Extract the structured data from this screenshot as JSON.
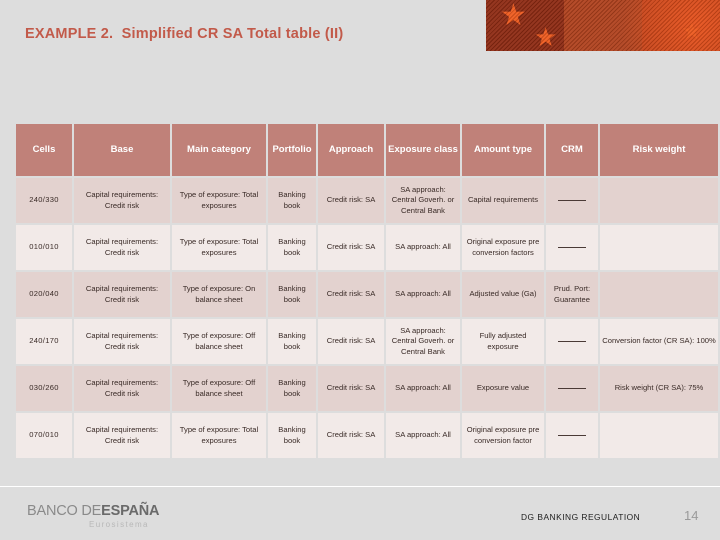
{
  "slide": {
    "title": "EXAMPLE 2.  Simplified CR SA Total table (II)",
    "title_color": "#c25a4a",
    "background_color": "#dddddd"
  },
  "banner": {
    "name": "spain-flag-graphic",
    "colors": [
      "#8e2a12",
      "#b0411d",
      "#bf3f17",
      "#ef5a1e"
    ],
    "star_glyph": "★"
  },
  "table": {
    "header_color": "#c08179",
    "row_dark_color": "#e3d2cf",
    "row_light_color": "#f2eae8",
    "columns": [
      "Cells",
      "Base",
      "Main category",
      "Portfolio",
      "Approach",
      "Exposure class",
      "Amount type",
      "CRM",
      "Risk weight"
    ],
    "rows": [
      {
        "cells": "240/330",
        "base": "Capital requirements: Credit risk",
        "main_category": "Type of exposure: Total exposures",
        "portfolio": "Banking book",
        "approach": "Credit risk: SA",
        "exposure_class": "SA approach: Central Goverh. or Central Bank",
        "amount_type": "Capital requirements",
        "crm": "—",
        "risk_weight": ""
      },
      {
        "cells": "010/010",
        "base": "Capital requirements: Credit risk",
        "main_category": "Type of exposure: Total exposures",
        "portfolio": "Banking book",
        "approach": "Credit risk: SA",
        "exposure_class": "SA approach: All",
        "amount_type": "Original exposure pre conversion factors",
        "crm": "—",
        "risk_weight": ""
      },
      {
        "cells": "020/040",
        "base": "Capital requirements: Credit risk",
        "main_category": "Type of exposure: On balance sheet",
        "portfolio": "Banking book",
        "approach": "Credit risk: SA",
        "exposure_class": "SA approach: All",
        "amount_type": "Adjusted value (Ga)",
        "crm": "Prud. Port: Guarantee",
        "risk_weight": ""
      },
      {
        "cells": "240/170",
        "base": "Capital requirements: Credit risk",
        "main_category": "Type of exposure: Off balance sheet",
        "portfolio": "Banking book",
        "approach": "Credit risk: SA",
        "exposure_class": "SA approach: Central Goverh. or Central Bank",
        "amount_type": "Fully adjusted exposure",
        "crm": "—",
        "risk_weight": "Conversion factor (CR SA): 100%"
      },
      {
        "cells": "030/260",
        "base": "Capital requirements: Credit risk",
        "main_category": "Type of exposure: Off balance sheet",
        "portfolio": "Banking book",
        "approach": "Credit risk: SA",
        "exposure_class": "SA approach: All",
        "amount_type": "Exposure value",
        "crm": "—",
        "risk_weight": "Risk weight (CR SA): 75%"
      },
      {
        "cells": "070/010",
        "base": "Capital requirements: Credit risk",
        "main_category": "Type of exposure: Total exposures",
        "portfolio": "Banking book",
        "approach": "Credit risk: SA",
        "exposure_class": "SA approach: All",
        "amount_type": "Original exposure pre conversion factor",
        "crm": "—",
        "risk_weight": ""
      }
    ]
  },
  "footer": {
    "logo_prefix": "BANCO DE",
    "logo_bold": "ESPAÑA",
    "logo_subtitle": "Eurosistema",
    "department": "DG BANKING REGULATION",
    "page_number": "14"
  }
}
